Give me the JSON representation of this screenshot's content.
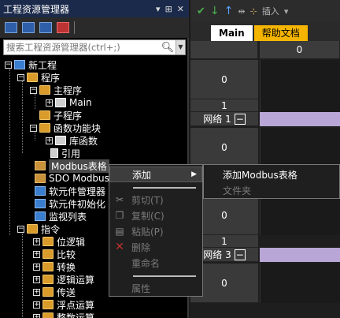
{
  "panel": {
    "title": "工程资源管理器",
    "title_buttons": [
      "▾",
      "⊞",
      "✕"
    ],
    "search_placeholder": "搜索工程资源管理器(ctrl+;)"
  },
  "tree": {
    "root": "新工程",
    "program": "程序",
    "main_program": "主程序",
    "main": "Main",
    "subroutine": "子程序",
    "function_block": "函数功能块",
    "library_function": "库函数",
    "reference": "引用",
    "modbus_table": "Modbus表格",
    "sdo_modbus": "SDO Modbus",
    "soft_element_manager": "软元件管理器",
    "soft_element_init": "软元件初始化",
    "monitor_list": "监视列表",
    "instructions": "指令",
    "bit_logic": "位逻辑",
    "compare": "比较",
    "convert": "转换",
    "logic_ops": "逻辑运算",
    "transfer": "传送",
    "float_ops": "浮点运算",
    "integer_ops": "整数运算"
  },
  "editor": {
    "toolbar_insert": "插入",
    "tab_main": "Main",
    "tab_help": "帮助文档",
    "column_header": "0",
    "row_zero": "0",
    "row_one": "1",
    "network_1": "网络 1",
    "network_3": "网络 3",
    "collapse_symbol": "−"
  },
  "context_menu": {
    "add": "添加",
    "cut": "剪切(T)",
    "copy": "复制(C)",
    "paste": "粘贴(P)",
    "delete": "删除",
    "rename": "重命名",
    "properties": "属性"
  },
  "submenu": {
    "add_modbus_table": "添加Modbus表格",
    "folder": "文件夹"
  }
}
